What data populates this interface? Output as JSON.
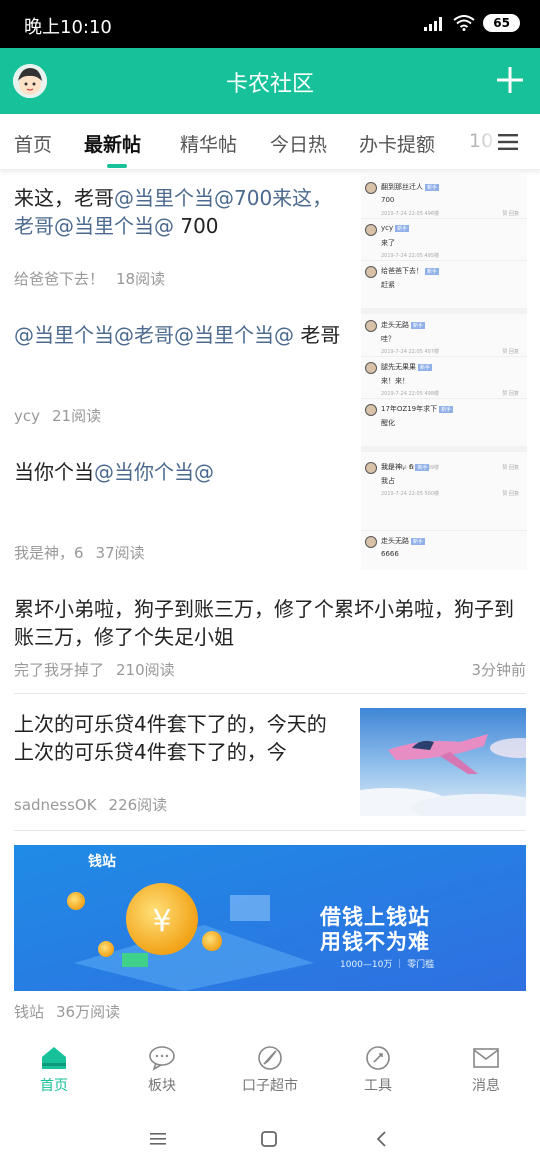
{
  "status_bar": {
    "time": "晚上10:10",
    "battery": "65"
  },
  "header": {
    "title": "卡农社区",
    "accent": "#17c29a"
  },
  "tabs": [
    {
      "label": "首页"
    },
    {
      "label": "最新帖"
    },
    {
      "label": "精华帖"
    },
    {
      "label": "今日热"
    },
    {
      "label": "办卡提额"
    },
    {
      "label": "10"
    }
  ],
  "posts": [
    {
      "t1": "来这，老哥",
      "m1": "@当里个当@700来这，老哥@当里个当@",
      "t2": " 700",
      "author": "给爸爸下去！",
      "reads": "18阅读"
    },
    {
      "m1": "@当里个当@老哥@当里个当@",
      "t2": " 老哥",
      "author": "ycy",
      "reads": "21阅读"
    },
    {
      "t1": "当你个当",
      "m1": "@当你个当@",
      "author": "我是神，6",
      "reads": "37阅读"
    },
    {
      "title": "累坏小弟啦，狗子到账三万，修了个累坏小弟啦，狗子到账三万，修了个失足小姐",
      "author": "完了我牙掉了",
      "reads": "210阅读",
      "time": "3分钟前"
    },
    {
      "title": "上次的可乐贷4件套下了的，今天的上次的可乐贷4件套下了的，今",
      "author": "sadnessOK",
      "reads": "226阅读"
    },
    {
      "author": "钱站",
      "reads": "36万阅读"
    }
  ],
  "thumbnail": {
    "rows": [
      {
        "name": "翻到那丝迁人",
        "tag": "新手",
        "text": "700",
        "date": "2019-7-24 22:05 496楼",
        "actions": "赞 回复"
      },
      {
        "name": "ycy",
        "tag": "新手",
        "text": "来了",
        "date": "2019-7-24 22:05 495楼",
        "actions": ""
      },
      {
        "name": "给爸爸下去！",
        "tag": "新手",
        "text": "赶紧",
        "date": "",
        "actions": ""
      },
      {
        "name": "走头无路",
        "tag": "新手",
        "text": "哇？",
        "date": "2019-7-24 22:05 497楼",
        "actions": "赞 回复"
      },
      {
        "name": "腿先无果果",
        "tag": "新手",
        "text": "来！来！",
        "date": "2019-7-24 22:05 498楼",
        "actions": "赞 回复"
      },
      {
        "name": "17年OZ19年求下",
        "tag": "新手",
        "text": "醒化",
        "date": "",
        "actions": ""
      },
      {
        "name": "",
        "tag": "",
        "text": "",
        "date": "2019-7-24 22:05 499楼",
        "actions": "赞 回复"
      },
      {
        "name": "我是神，6",
        "tag": "新手",
        "text": "我占",
        "date": "2019-7-24 22:05 500楼",
        "actions": "赞 回复"
      },
      {
        "name": "走头无路",
        "tag": "新手",
        "text": "6666",
        "date": "",
        "actions": ""
      }
    ]
  },
  "banner": {
    "brand": "钱站",
    "line1": "借钱上钱站",
    "line2": "用钱不为难",
    "sub": "1000—10万 ｜ 零门槛"
  },
  "bottom_nav": [
    {
      "label": "首页",
      "icon": "home-icon"
    },
    {
      "label": "板块",
      "icon": "chat-bubble-icon"
    },
    {
      "label": "口子超市",
      "icon": "compass-icon"
    },
    {
      "label": "工具",
      "icon": "tool-icon"
    },
    {
      "label": "消息",
      "icon": "mail-icon"
    }
  ]
}
